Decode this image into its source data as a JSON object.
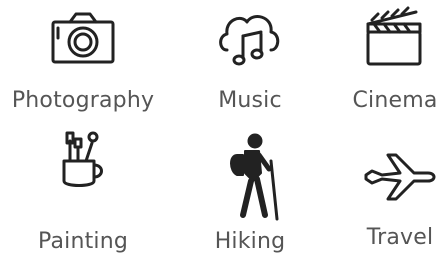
{
  "interests": [
    {
      "label": "Photography",
      "icon": "camera-icon"
    },
    {
      "label": "Music",
      "icon": "music-cloud-icon"
    },
    {
      "label": "Cinema",
      "icon": "clapperboard-icon"
    },
    {
      "label": "Painting",
      "icon": "paintbrush-cup-icon"
    },
    {
      "label": "Hiking",
      "icon": "hiker-icon"
    },
    {
      "label": "Travel",
      "icon": "airplane-icon"
    }
  ],
  "colors": {
    "icon": "#222222",
    "label": "#555555",
    "background": "#ffffff"
  }
}
